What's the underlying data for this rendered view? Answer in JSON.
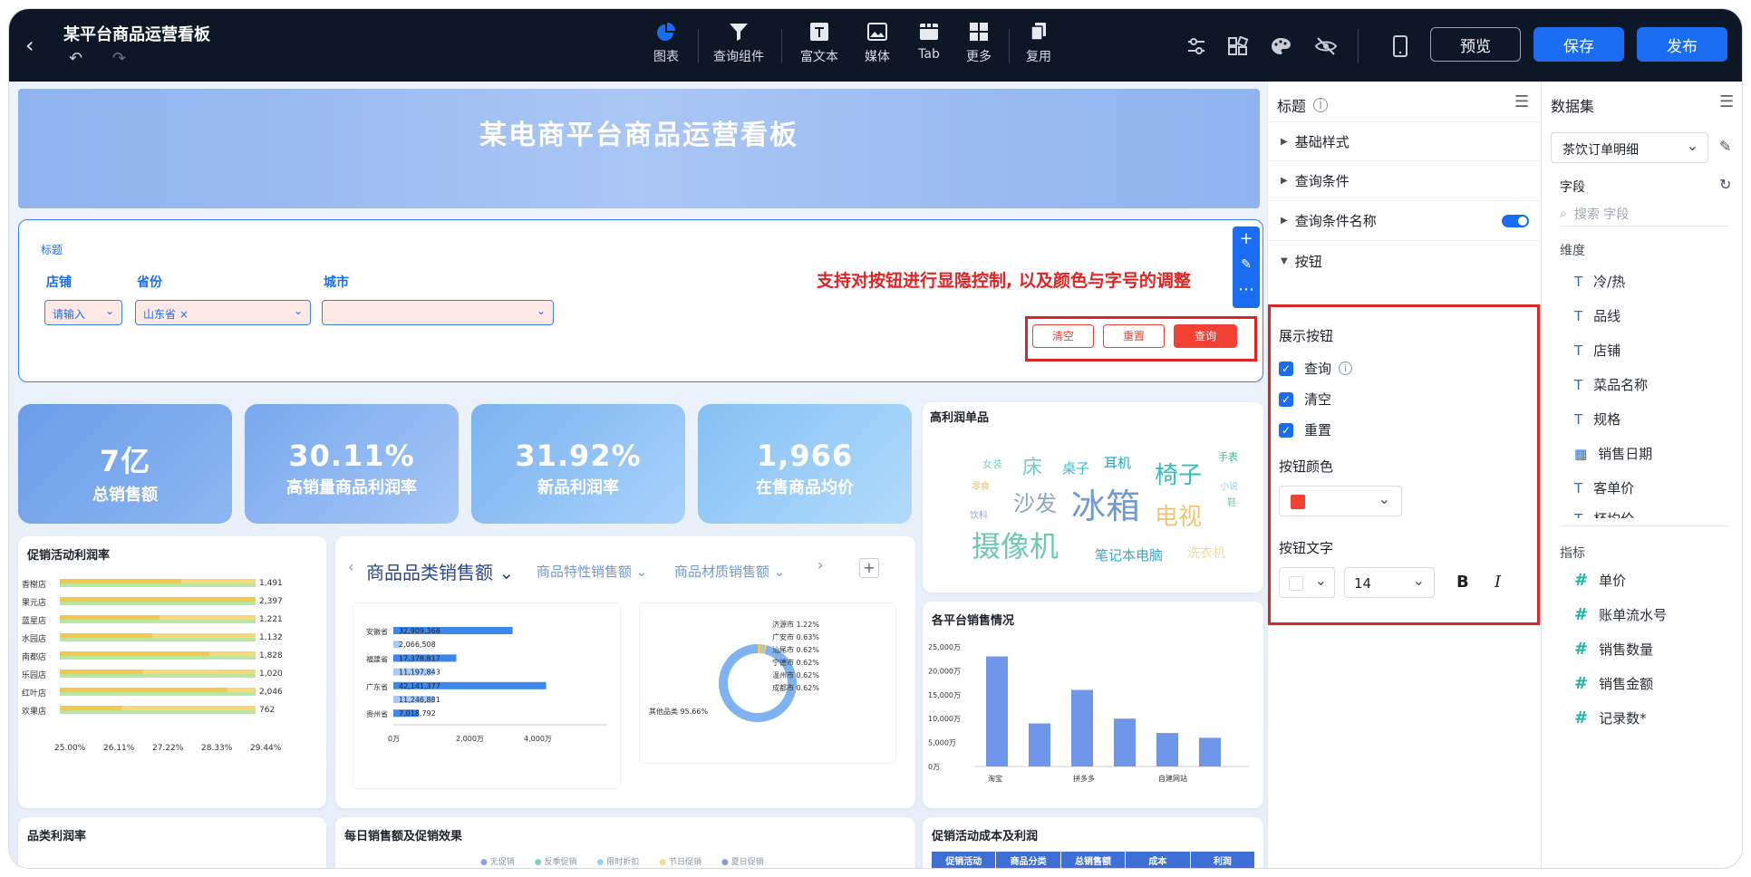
{
  "topbar": {
    "title": "某平台商品运营看板",
    "tools": [
      {
        "label": "图表",
        "icon": "pie-chart-icon"
      },
      {
        "label": "查询组件",
        "icon": "filter-icon"
      },
      {
        "label": "富文本",
        "icon": "text-icon"
      },
      {
        "label": "媒体",
        "icon": "image-icon"
      },
      {
        "label": "Tab",
        "icon": "tab-icon"
      },
      {
        "label": "更多",
        "icon": "grid-icon"
      },
      {
        "label": "复用",
        "icon": "copy-icon"
      }
    ],
    "preview_label": "预览",
    "save_label": "保存",
    "publish_label": "发布"
  },
  "banner": {
    "title": "某电商平台商品运营看板"
  },
  "query": {
    "title": "标题",
    "filters": [
      {
        "label": "店铺",
        "value": "请输入"
      },
      {
        "label": "省份",
        "value": "山东省"
      },
      {
        "label": "城市",
        "value": ""
      }
    ],
    "annotation": "支持对按钮进行显隐控制, 以及颜色与字号的调整",
    "buttons": {
      "clear": "清空",
      "reset": "重置",
      "query": "查询"
    }
  },
  "kpis": [
    {
      "value": "7亿",
      "label": "总销售额"
    },
    {
      "value": "30.11%",
      "label": "高销量商品利润率"
    },
    {
      "value": "31.92%",
      "label": "新品利润率"
    },
    {
      "value": "1,966",
      "label": "在售商品均价"
    }
  ],
  "wordcloud": {
    "title": "高利润单品",
    "words": [
      "女装",
      "床",
      "桌子",
      "耳机",
      "椅子",
      "手表",
      "零食",
      "沙发",
      "冰箱",
      "小说",
      "鞋",
      "饮料",
      "电视",
      "摄像机",
      "笔记本电脑",
      "洗衣机"
    ]
  },
  "promo_chart": {
    "title": "促销活动利润率",
    "chart_data": {
      "type": "bar",
      "categories": [
        "香榭店",
        "果元店",
        "蓝星店",
        "水园店",
        "南都店",
        "乐园店",
        "红叶店",
        "欢果店"
      ],
      "values": [
        1491,
        2397,
        1221,
        1132,
        1828,
        1020,
        2046,
        762
      ],
      "x_ticks": [
        "25.00%",
        "26.11%",
        "27.22%",
        "28.33%",
        "29.44%"
      ]
    }
  },
  "category_tabs": {
    "tabs": [
      "商品品类销售额",
      "商品特性销售额",
      "商品材质销售额"
    ],
    "bar": {
      "chart_data": {
        "type": "bar",
        "categories": [
          "安徽省",
          "",
          "福建省",
          "",
          "广东省",
          "",
          "贵州省"
        ],
        "values": [
          32909368,
          2066508,
          17378817,
          11197843,
          42141377,
          11246881,
          7018792
        ],
        "value_labels": [
          "32,909,368",
          "2,066,508",
          "17,378,817",
          "11,197,843",
          "42,141,377",
          "11,246,881",
          "7,018,792"
        ],
        "x_ticks": [
          "0万",
          "2,000万",
          "4,000万"
        ]
      }
    },
    "donut": {
      "chart_data": {
        "type": "pie",
        "labels": [
          "济源市",
          "广安市",
          "汕尾市",
          "宁德市",
          "温州市",
          "成都市",
          "其他品类"
        ],
        "values": [
          1.22,
          0.63,
          0.62,
          0.62,
          0.62,
          0.62,
          95.66
        ],
        "label_texts": [
          "济源市 1.22%",
          "广安市 0.63%",
          "汕尾市 0.62%",
          "宁德市 0.62%",
          "温州市 0.62%",
          "成都市 0.62%",
          "其他品类 95.66%"
        ]
      }
    }
  },
  "platform_chart": {
    "title": "各平台销售情况",
    "chart_data": {
      "type": "bar",
      "categories": [
        "淘宝",
        "",
        "拼多多",
        "",
        "自建网站",
        ""
      ],
      "values": [
        23000,
        9000,
        16000,
        10000,
        7000,
        6000
      ],
      "y_ticks": [
        "25,000万",
        "20,000万",
        "15,000万",
        "10,000万",
        "5,000万",
        "0万"
      ],
      "ylim": [
        0,
        25000
      ]
    }
  },
  "bottom": {
    "cat_profit_title": "品类利润率",
    "daily_title": "每日销售额及促销效果",
    "daily_legend": [
      "无促销",
      "反季促销",
      "限时折扣",
      "节日促销",
      "夏日促销"
    ],
    "cost_title": "促销活动成本及利润",
    "cost_headers": [
      "促销活动",
      "商品分类",
      "总销售额",
      "成本",
      "利润"
    ]
  },
  "props_panel": {
    "title": "标题",
    "sections": [
      "基础样式",
      "查询条件",
      "查询条件名称",
      "按钮"
    ],
    "show_buttons_label": "展示按钮",
    "checks": [
      "查询",
      "清空",
      "重置"
    ],
    "color_label": "按钮颜色",
    "color": "#f04134",
    "text_label": "按钮文字",
    "font_size": "14",
    "bold": "B",
    "italic": "I"
  },
  "dataset_panel": {
    "title": "数据集",
    "dataset": "茶饮订单明细",
    "fields_label": "字段",
    "search_placeholder": "搜索 字段",
    "dim_label": "维度",
    "dims": [
      "冷/热",
      "品线",
      "店铺",
      "菜品名称",
      "规格",
      "销售日期",
      "客单价",
      "杯均价"
    ],
    "measure_label": "指标",
    "measures": [
      "单价",
      "账单流水号",
      "销售数量",
      "销售金额",
      "记录数*"
    ]
  },
  "colors": {
    "accent": "#1a6df0",
    "danger": "#f04134",
    "topbar": "#0e1726"
  }
}
